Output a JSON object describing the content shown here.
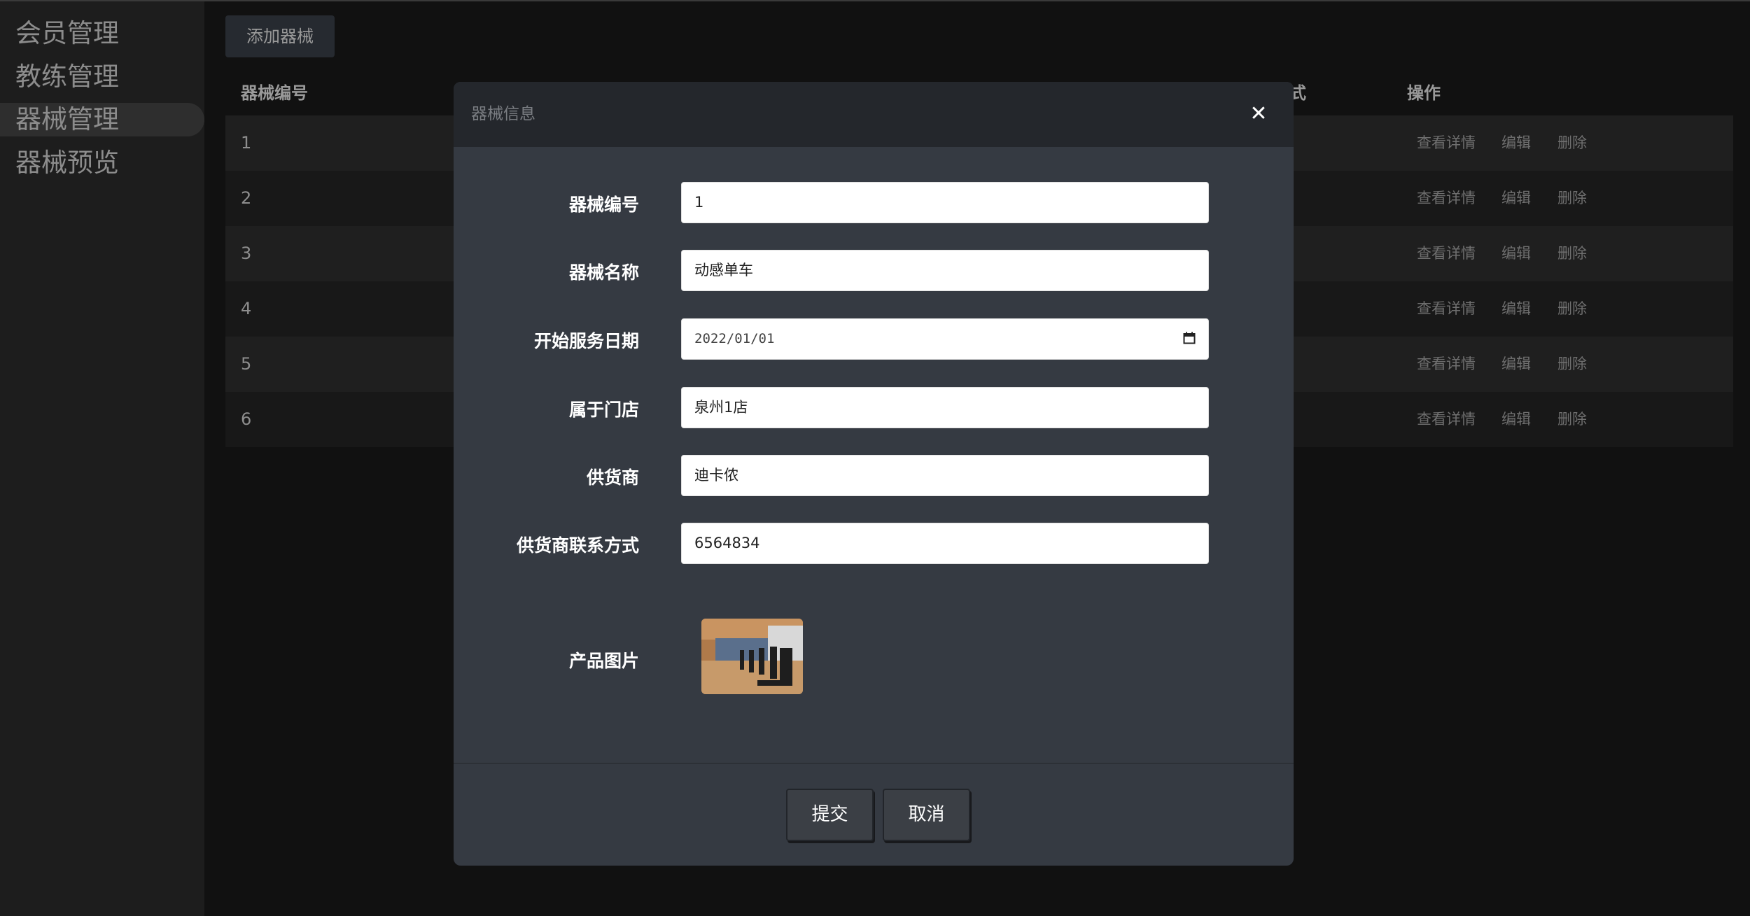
{
  "sidebar": {
    "items": [
      {
        "label": "会员管理",
        "active": false
      },
      {
        "label": "教练管理",
        "active": false
      },
      {
        "label": "器械管理",
        "active": true
      },
      {
        "label": "器械预览",
        "active": false
      }
    ]
  },
  "toolbar": {
    "add_label": "添加器械"
  },
  "table": {
    "headers": {
      "id": "器械编号",
      "partial": "式",
      "actions": "操作"
    },
    "rows": [
      {
        "id": "1"
      },
      {
        "id": "2"
      },
      {
        "id": "3"
      },
      {
        "id": "4"
      },
      {
        "id": "5"
      },
      {
        "id": "6"
      }
    ],
    "actions": {
      "view": "查看详情",
      "edit": "编辑",
      "delete": "删除"
    }
  },
  "modal": {
    "title": "器械信息",
    "close_icon": "close-icon",
    "fields": [
      {
        "label": "器械编号",
        "value": "1"
      },
      {
        "label": "器械名称",
        "value": "动感单车"
      },
      {
        "label": "开始服务日期",
        "value": "2022/01/01"
      },
      {
        "label": "属于门店",
        "value": "泉州1店"
      },
      {
        "label": "供货商",
        "value": "迪卡侬"
      },
      {
        "label": "供货商联系方式",
        "value": "6564834"
      }
    ],
    "image_label": "产品图片",
    "submit_label": "提交",
    "cancel_label": "取消"
  },
  "colors": {
    "background": "#111111",
    "sidebar": "#1d1d1d",
    "modal": "#353a42",
    "modal_header": "#24272c"
  }
}
